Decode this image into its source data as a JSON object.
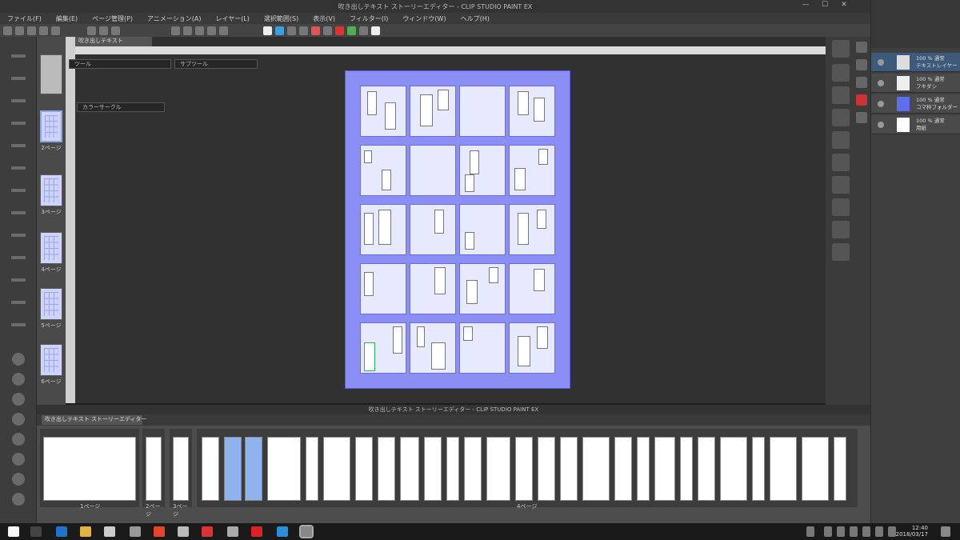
{
  "window": {
    "title": "吹き出しテキスト ストーリーエディター - CLIP STUDIO PAINT EX",
    "controls": [
      "—",
      "☐",
      "✕"
    ]
  },
  "menu": [
    "ファイル(F)",
    "編集(E)",
    "ページ管理(P)",
    "アニメーション(A)",
    "レイヤー(L)",
    "選択範囲(S)",
    "表示(V)",
    "フィルター(I)",
    "ウィンドウ(W)",
    "ヘルプ(H)"
  ],
  "document_tab": {
    "label": "吹き出しテキスト"
  },
  "page_manager": {
    "pages": [
      {
        "label": "2ページ",
        "selected": true
      },
      {
        "label": "3ページ",
        "selected": false
      },
      {
        "label": "4ページ",
        "selected": false
      },
      {
        "label": "5ページ",
        "selected": false
      },
      {
        "label": "6ページ",
        "selected": false
      }
    ]
  },
  "tool_property": {
    "dropdown1": "ツール",
    "dropdown2": "サブツール",
    "dropdown3": "カラーサークル"
  },
  "layers": [
    {
      "name": "100 % 通常",
      "sub": "テキストレイヤー",
      "selected": true
    },
    {
      "name": "100 % 通常",
      "sub": "フキダシ",
      "selected": false
    },
    {
      "name": "100 % 通常",
      "sub": "コマ枠フォルダー",
      "selected": false
    },
    {
      "name": "100 % 通常",
      "sub": "用紙",
      "selected": false
    }
  ],
  "story_editor": {
    "title": "吹き出しテキスト ストーリーエディター - CLIP STUDIO PAINT EX",
    "tab": "吹き出しテキスト ストーリーエディター",
    "page_labels": [
      "1ページ",
      "2ページ",
      "3ページ",
      "4ページ"
    ]
  },
  "taskbar": {
    "time": "12:40",
    "date": "2018/03/17"
  }
}
